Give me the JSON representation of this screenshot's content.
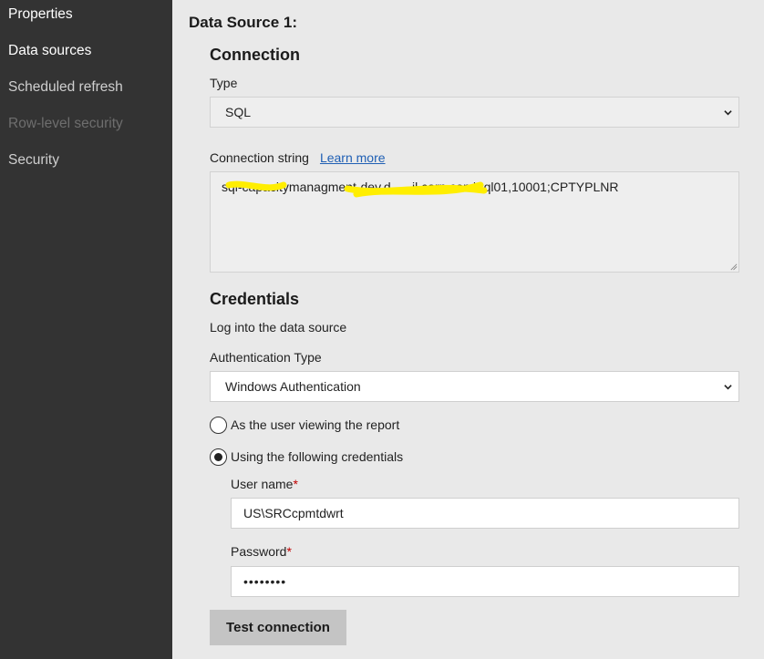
{
  "sidebar": {
    "items": [
      {
        "label": "Properties",
        "state": "normal"
      },
      {
        "label": "Data sources",
        "state": "active"
      },
      {
        "label": "Scheduled refresh",
        "state": "normal"
      },
      {
        "label": "Row-level security",
        "state": "disabled"
      },
      {
        "label": "Security",
        "state": "normal"
      }
    ]
  },
  "datasource": {
    "title": "Data Source 1:",
    "connection": {
      "heading": "Connection",
      "type_label": "Type",
      "type_value": "SQL",
      "string_label": "Connection string",
      "learn_more": "Learn more",
      "string_value": "sql-capacitymanagment-dev.d......il.corp.com\\sql01,10001;CPTYPLNR",
      "redaction_color": "#ffee00"
    },
    "credentials": {
      "heading": "Credentials",
      "intro": "Log into the data source",
      "auth_label": "Authentication Type",
      "auth_value": "Windows Authentication",
      "option_viewing_user": "As the user viewing the report",
      "option_following": "Using the following credentials",
      "selected_option": "following",
      "username_label": "User name",
      "password_label": "Password",
      "required_mark": "*",
      "username_value": "US\\SRCcpmtdwrt",
      "password_value": "••••••••"
    },
    "test_button": "Test connection"
  },
  "colors": {
    "sidebar_bg": "#333333",
    "page_bg": "#e9e9e9",
    "link": "#1f5fb4",
    "required": "#c00000",
    "button_bg": "#c4c4c4"
  }
}
